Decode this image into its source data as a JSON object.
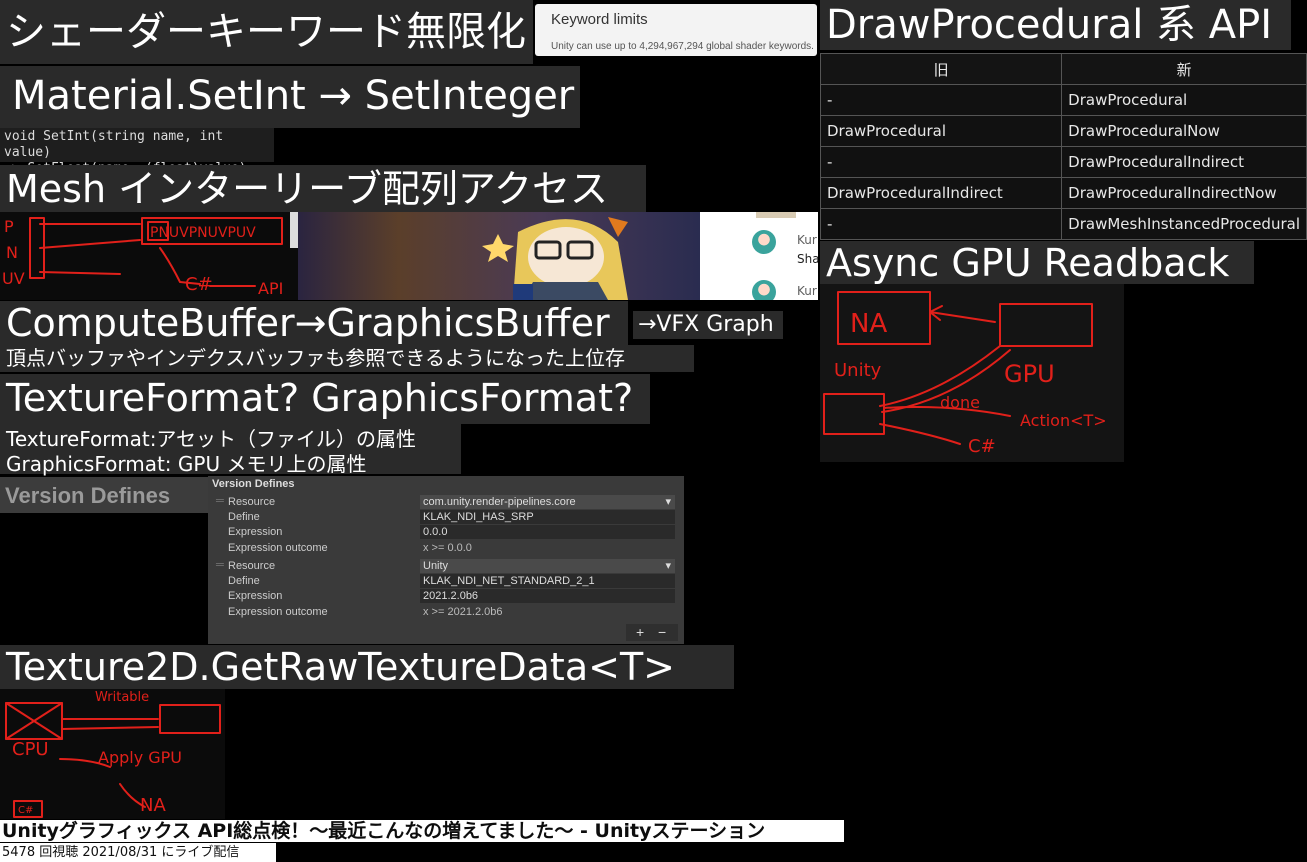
{
  "captions": {
    "shader_keyword": "シェーダーキーワード無限化",
    "set_int": "Material.SetInt → SetInteger",
    "mesh_interleave": "Mesh インターリーブ配列アクセス",
    "compute_buffer": "ComputeBuffer→GraphicsBuffer",
    "vfx_graph": "→VFX Graph",
    "buffer_desc": "頂点バッファやインデクスバッファも参照できるようになった上位存",
    "texture_format": "TextureFormat? GraphicsFormat?",
    "texture_format_desc1": "TextureFormat:アセット（ファイル）の属性",
    "texture_format_desc2": "GraphicsFormat: GPU メモリ上の属性",
    "version_defines": "Version Defines",
    "raw_texture": "Texture2D.GetRawTextureData<T>",
    "draw_procedural": "DrawProcedural 系 API",
    "async_readback": "Async GPU Readback"
  },
  "code": {
    "line1": "void SetInt(string name, int value)",
    "line2": "  => SetFloat(name, (float)value);"
  },
  "keyword_limits": {
    "title": "Keyword limits",
    "text": "Unity can use up to 4,294,967,294 global shader keywords."
  },
  "draw_table": {
    "headers": [
      "旧",
      "新"
    ],
    "rows": [
      [
        "-",
        "DrawProcedural"
      ],
      [
        "DrawProcedural",
        "DrawProceduralNow"
      ],
      [
        "-",
        "DrawProceduralIndirect"
      ],
      [
        "DrawProceduralIndirect",
        "DrawProceduralIndirectNow"
      ],
      [
        "-",
        "DrawMeshInstancedProcedural"
      ]
    ]
  },
  "version_panel": {
    "header": "Version Defines",
    "groups": [
      {
        "resource": "com.unity.render-pipelines.core",
        "define": "KLAK_NDI_HAS_SRP",
        "expression": "0.0.0",
        "outcome": "x >= 0.0.0"
      },
      {
        "resource": "Unity",
        "define": "KLAK_NDI_NET_STANDARD_2_1",
        "expression": "2021.2.0b6",
        "outcome": "x >= 2021.2.0b6"
      }
    ],
    "labels": {
      "resource": "Resource",
      "define": "Define",
      "expression": "Expression",
      "outcome": "Expression outcome"
    },
    "add": "+",
    "remove": "−"
  },
  "chat": {
    "items": [
      {
        "name": "Kur",
        "text": "Sha"
      },
      {
        "name": "Kur",
        "text": ""
      }
    ]
  },
  "sketch_labels": {
    "mesh": [
      "P",
      "N",
      "UV",
      "PNUVPNUVPUV",
      "C#",
      "API"
    ],
    "async": [
      "NA",
      "Unity",
      "GPU",
      "done",
      "Action<T>",
      "C#"
    ],
    "raw": [
      "Writable",
      "CPU",
      "Apply GPU",
      "NA",
      "C#"
    ]
  },
  "video": {
    "title": "Unityグラフィックス API総点検！〜最近こんなの増えてました〜 - Unityステーション",
    "meta": "5478 回視聴  2021/08/31 にライブ配信"
  },
  "colors": {
    "caption_bg": "#2a2a2a",
    "sketch_red": "#e1201a",
    "accent_gold": "#e8c75a"
  }
}
